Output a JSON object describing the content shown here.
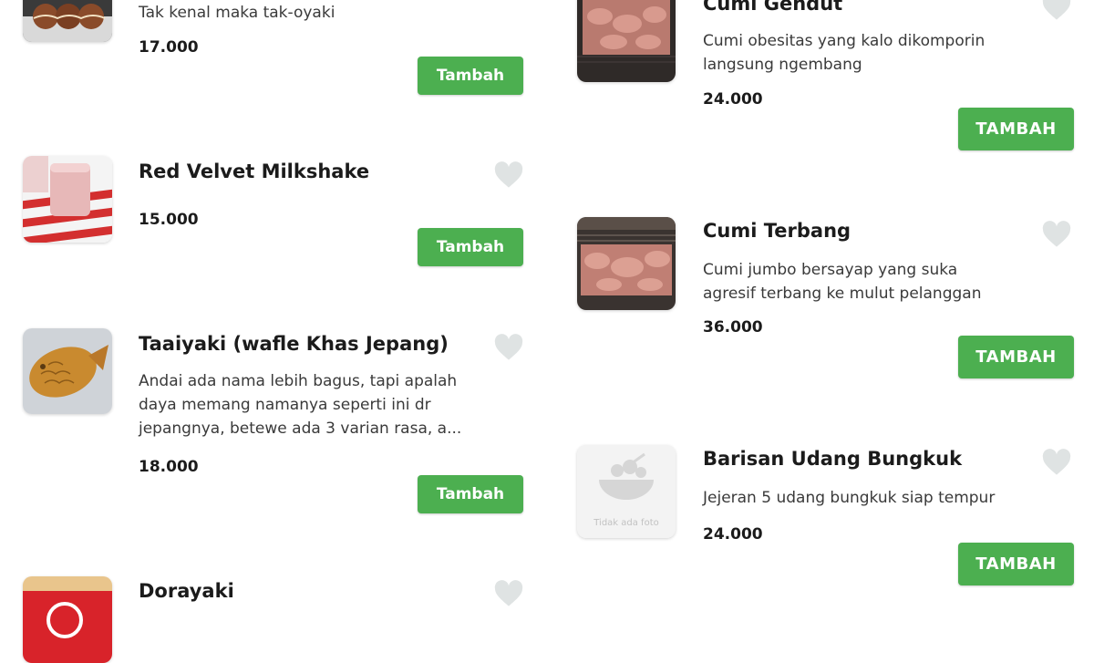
{
  "accent_color": "#4caf50",
  "heart_color": "#dfe3e3",
  "left_column": [
    {
      "title": "",
      "desc": [
        "Tak kenal maka tak-oyaki"
      ],
      "price": "17.000",
      "button": "Tambah",
      "image": "takoyaki-photo"
    },
    {
      "title": "Red Velvet Milkshake",
      "desc": [],
      "price": "15.000",
      "button": "Tambah",
      "image": "milkshake-photo"
    },
    {
      "title": "Taaiyaki (wafle Khas Jepang)",
      "desc": [
        "Andai ada nama lebih bagus, tapi apalah",
        "daya memang namanya seperti ini dr",
        "jepangnya, betewe ada 3 varian rasa, a..."
      ],
      "price": "18.000",
      "button": "Tambah",
      "image": "taiyaki-photo"
    },
    {
      "title": "Dorayaki",
      "desc": [],
      "price": "",
      "button": "",
      "image": "dorayaki-photo"
    }
  ],
  "right_column": [
    {
      "title": "Cumi Gendut",
      "desc": [
        "Cumi obesitas yang kalo dikomporin",
        "langsung ngembang"
      ],
      "price": "24.000",
      "button": "TAMBAH",
      "image": "squid-grill-photo"
    },
    {
      "title": "Cumi Terbang",
      "desc": [
        "Cumi jumbo bersayap yang suka",
        "agresif terbang ke mulut pelanggan"
      ],
      "price": "36.000",
      "button": "TAMBAH",
      "image": "squid-grill-photo"
    },
    {
      "title": "Barisan Udang Bungkuk",
      "desc": [
        "Jejeran 5 udang bungkuk siap tempur"
      ],
      "price": "24.000",
      "button": "TAMBAH",
      "image": "no-photo-placeholder",
      "placeholder_text": "Tidak ada foto"
    }
  ]
}
